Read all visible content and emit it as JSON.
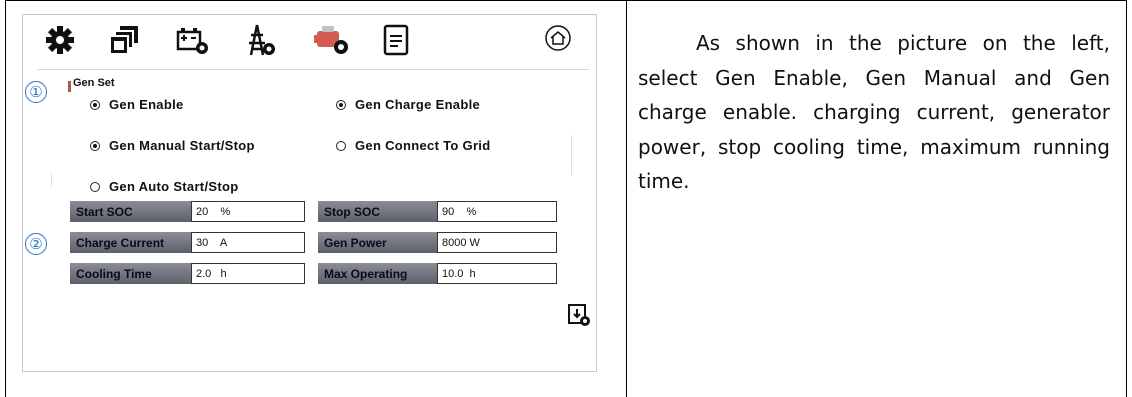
{
  "panel": {
    "toolbar_icons": [
      "gear-icon",
      "parallel-icon",
      "battery-settings-icon",
      "grid-settings-icon",
      "generator-settings-icon",
      "document-icon",
      "home-icon"
    ],
    "marker_1": "①",
    "marker_2": "②",
    "section_title": "Gen Set",
    "radios": [
      {
        "label": "Gen Enable",
        "checked": true
      },
      {
        "label": "Gen Charge Enable",
        "checked": true
      },
      {
        "label": "Gen Manual Start/Stop",
        "checked": true
      },
      {
        "label": "Gen Connect To Grid",
        "checked": false
      },
      {
        "label": "Gen Auto Start/Stop",
        "checked": false
      }
    ],
    "fields": [
      {
        "label": "Start SOC",
        "value": "20    %"
      },
      {
        "label": "Stop SOC",
        "value": "90    %"
      },
      {
        "label": "Charge Current",
        "value": "30    A"
      },
      {
        "label": "Gen Power",
        "value": "8000 W"
      },
      {
        "label": "Cooling Time",
        "value": "2.0   h"
      },
      {
        "label": "Max Operating",
        "value": "10.0  h"
      }
    ],
    "save_icon": "save-settings-icon"
  },
  "description": "As shown in the picture on the left, select Gen Enable, Gen Manual and Gen charge enable. charging current, generator power, stop cooling time, maximum running time.",
  "colors": {
    "marker": "#2a73c7",
    "label_bg": "#6f727b"
  }
}
